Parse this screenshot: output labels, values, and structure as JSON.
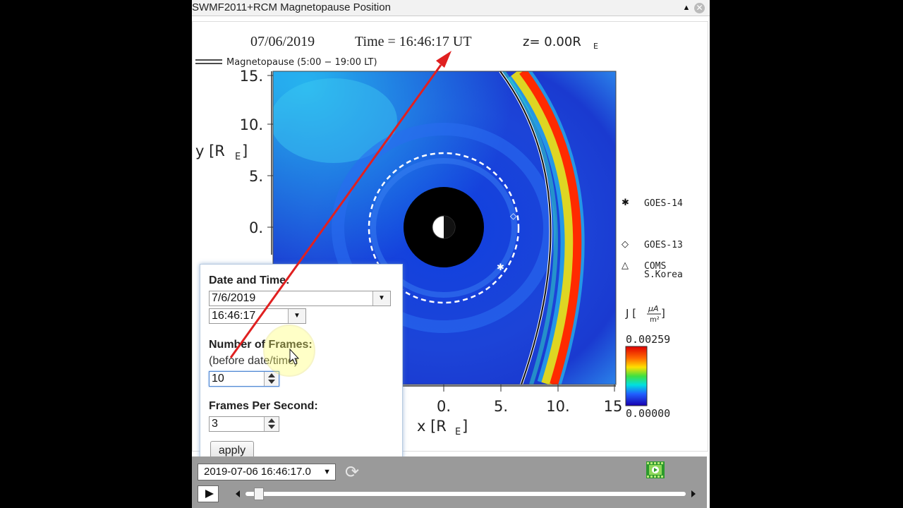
{
  "window": {
    "title": "SWMF2011+RCM Magnetopause Position",
    "collapse_icon": "collapse-icon",
    "close_icon": "close-icon"
  },
  "figure": {
    "header_date": "07/06/2019",
    "header_time_label": "Time = 16:46:17 UT",
    "header_z": "z= 0.00R",
    "header_z_sub": "E",
    "legend_magnetopause": "Magnetopause (5:00 − 19:00 LT)",
    "y_axis_label": "y [R",
    "y_axis_sub": "E",
    "x_axis_label": "x [R",
    "x_axis_sub": "E",
    "y_ticks": [
      "15.",
      "10.",
      "5.",
      "0."
    ],
    "x_ticks": [
      "0.",
      "5.",
      "10.",
      "15"
    ],
    "satellites": [
      {
        "marker": "✱",
        "label": "GOES-14"
      },
      {
        "marker": "◇",
        "label": "GOES-13"
      },
      {
        "marker": "△",
        "label": "COMS",
        "label2": "S.Korea"
      }
    ],
    "colorbar": {
      "label": "J [",
      "unit_top": "μA",
      "unit_bottom": "m²",
      "max": "0.00259",
      "min": "0.00000"
    },
    "colors": {
      "background": "#1a3fd6",
      "magnetopause_band": "#ff2a00"
    }
  },
  "popup": {
    "date_time_label": "Date and Time:",
    "date_value": "7/6/2019",
    "time_value": "16:46:17",
    "frames_label": "Number of Frames:",
    "frames_hint": "(before date/time)",
    "frames_value": "10",
    "fps_label": "Frames Per Second:",
    "fps_value": "3",
    "apply_label": "apply"
  },
  "controls": {
    "current_time": "2019-07-06 16:46:17.0",
    "refresh_icon": "refresh-icon",
    "movie_icon": "movie-icon",
    "play_icon": "play-icon",
    "slider_position": 0.02
  }
}
